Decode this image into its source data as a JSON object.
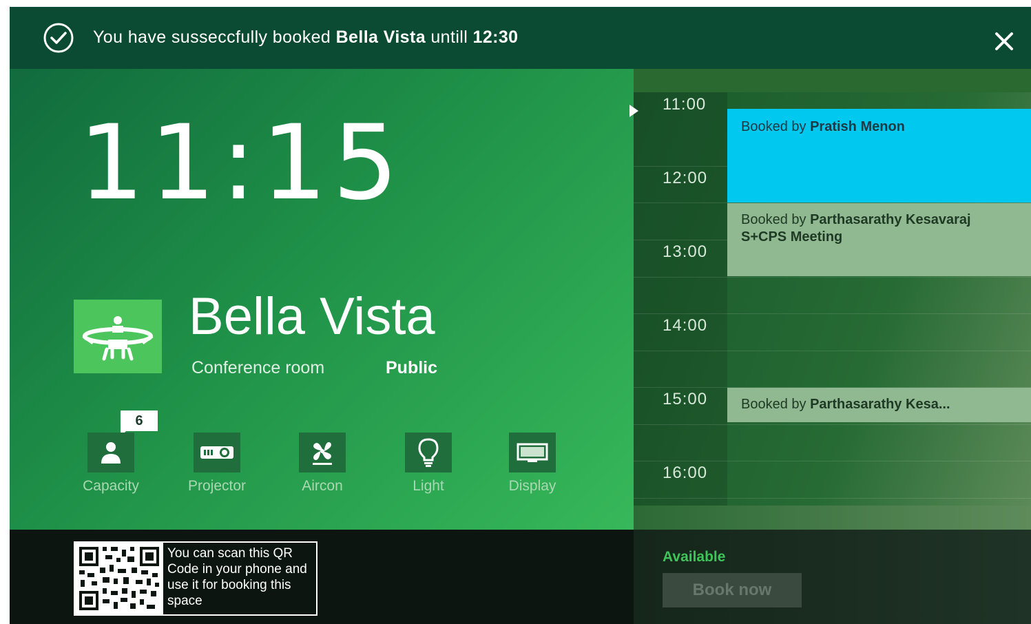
{
  "banner": {
    "text_prefix": "You have susseccfully booked",
    "room": "Bella Vista",
    "text_mid": "untill",
    "until": "12:30",
    "close_icon": "close-icon",
    "check_icon": "check-circle-icon"
  },
  "clock": "11:15",
  "room": {
    "name": "Bella Vista",
    "type": "Conference room",
    "access": "Public",
    "icon": "meeting-table-icon"
  },
  "amenities": [
    {
      "label": "Capacity",
      "icon": "person-icon",
      "badge": "6"
    },
    {
      "label": "Projector",
      "icon": "projector-icon"
    },
    {
      "label": "Aircon",
      "icon": "fan-icon"
    },
    {
      "label": "Light",
      "icon": "lightbulb-icon"
    },
    {
      "label": "Display",
      "icon": "display-icon"
    }
  ],
  "schedule": {
    "hours": [
      "11:00",
      "12:00",
      "13:00",
      "14:00",
      "15:00",
      "16:00"
    ],
    "bookings": [
      {
        "prefix": "Booked by",
        "name": "Pratish Menon",
        "extra": "",
        "color": "#00c8ee"
      },
      {
        "prefix": "Booked by",
        "name": "Parthasarathy Kesavaraj",
        "extra": "S+CPS Meeting",
        "color": "#90b992"
      },
      {
        "prefix": "Booked by",
        "name": "Parthasarathy Kesa...",
        "extra": "",
        "color": "#90b992"
      }
    ]
  },
  "footer": {
    "qr_text": "You can scan this QR Code in your phone and use it for booking this space",
    "status": "Available",
    "book_label": "Book now"
  },
  "colors": {
    "accent_green": "#3fc45a",
    "booking_blue": "#00c8ee",
    "booking_sage": "#90b992"
  }
}
